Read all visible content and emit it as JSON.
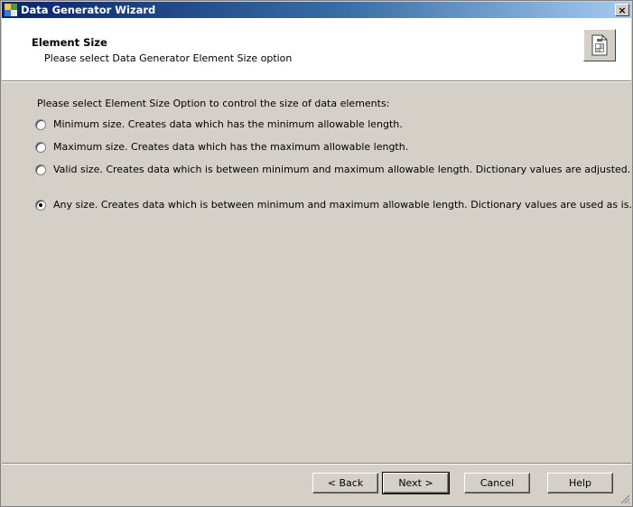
{
  "window": {
    "title": "Data Generator Wizard",
    "close_symbol": "×"
  },
  "header": {
    "title": "Element Size",
    "subtitle": "Please select Data Generator Element Size option",
    "icon": "document-wizard-icon"
  },
  "content": {
    "instruction": "Please select Element Size Option to control the size of data elements:",
    "options": [
      {
        "label": "Minimum size. Creates data which has the minimum allowable length.",
        "checked": false
      },
      {
        "label": "Maximum size. Creates data which has the maximum allowable length.",
        "checked": false
      },
      {
        "label": "Valid size. Creates data which is between minimum and maximum allowable length. Dictionary values are adjusted.",
        "checked": false
      },
      {
        "label": "Any size. Creates data which is between minimum and maximum allowable length. Dictionary values are used as is.",
        "checked": true
      }
    ]
  },
  "buttons": {
    "back": "< Back",
    "next": "Next >",
    "cancel": "Cancel",
    "help": "Help"
  },
  "colors": {
    "face": "#d4d0c8",
    "title_gradient_start": "#0a246a",
    "title_gradient_end": "#a6caf0"
  }
}
